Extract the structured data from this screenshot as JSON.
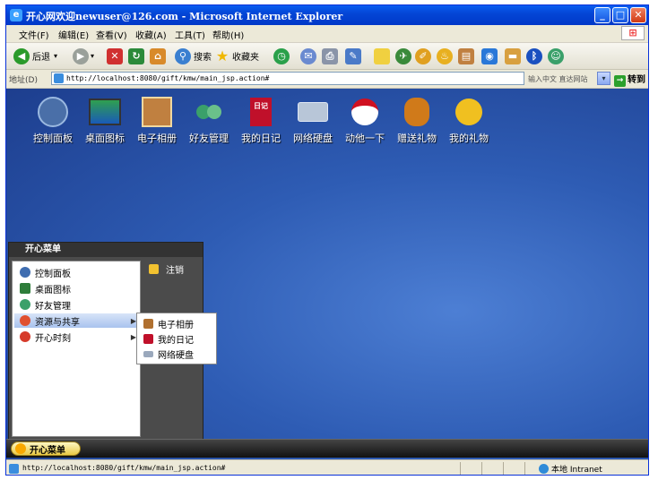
{
  "window": {
    "title": "开心网欢迎newuser@126.com - Microsoft Internet Explorer",
    "controls": {
      "minimize": "_",
      "maximize": "□",
      "close": "✕"
    }
  },
  "menubar": {
    "items": [
      "文件(F)",
      "编辑(E)",
      "查看(V)",
      "收藏(A)",
      "工具(T)",
      "帮助(H)"
    ]
  },
  "toolbar": {
    "back_label": "后退",
    "search_label": "搜索",
    "favorites_label": "收藏夹"
  },
  "addressbar": {
    "label": "地址(D)",
    "url": "http://localhost:8080/gift/kmw/main_jsp.action#",
    "hint": "输入中文 直达网站",
    "go_label": "转到"
  },
  "desktop": {
    "icons": [
      {
        "label": "控制面板",
        "color": "#4a6fa8"
      },
      {
        "label": "桌面图标",
        "color": "#2f9e3f"
      },
      {
        "label": "电子相册",
        "color": "#c08040"
      },
      {
        "label": "好友管理",
        "color": "#3aa06a"
      },
      {
        "label": "我的日记",
        "color": "#c0102a"
      },
      {
        "label": "网络硬盘",
        "color": "#b8c6d8"
      },
      {
        "label": "动他一下",
        "color": "#ffffff"
      },
      {
        "label": "赠送礼物",
        "color": "#d07a1a"
      },
      {
        "label": "我的礼物",
        "color": "#f0c020"
      }
    ],
    "diary_badge": "日记"
  },
  "start_menu": {
    "title": "开心菜单",
    "items": [
      {
        "label": "控制面板",
        "color": "#3f6db0"
      },
      {
        "label": "桌面图标",
        "color": "#2e7d3a"
      },
      {
        "label": "好友管理",
        "color": "#3aa06a"
      },
      {
        "label": "资源与共享",
        "color": "#e05030"
      },
      {
        "label": "开心时刻",
        "color": "#d63a2a"
      }
    ],
    "logout_label": "注销",
    "submenu": [
      {
        "label": "电子相册",
        "color": "#b07030"
      },
      {
        "label": "我的日记",
        "color": "#c0102a"
      },
      {
        "label": "网络硬盘",
        "color": "#9aa8bc"
      }
    ]
  },
  "taskbar": {
    "start_label": "开心菜单"
  },
  "statusbar": {
    "text": "http://localhost:8080/gift/kmw/main_jsp.action#",
    "zone": "本地 Intranet"
  }
}
